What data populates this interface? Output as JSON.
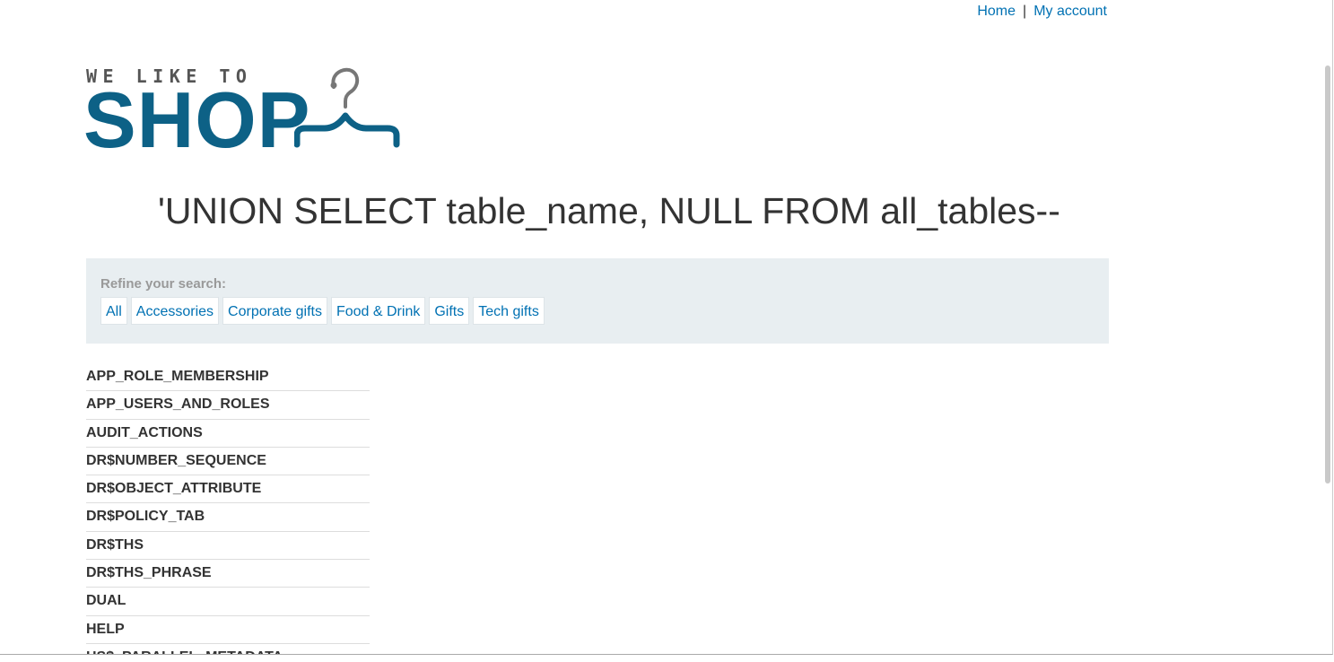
{
  "header": {
    "links": [
      {
        "label": "Home"
      },
      {
        "label": "My account"
      }
    ],
    "separator": "|"
  },
  "logo": {
    "tagline": "WE LIKE TO",
    "wordmark": "SHOP",
    "icon": "hanger-icon"
  },
  "page": {
    "heading": "'UNION SELECT table_name, NULL FROM all_tables--"
  },
  "filters": {
    "label": "Refine your search:",
    "items": [
      {
        "label": "All"
      },
      {
        "label": "Accessories"
      },
      {
        "label": "Corporate gifts"
      },
      {
        "label": "Food & Drink"
      },
      {
        "label": "Gifts"
      },
      {
        "label": "Tech gifts"
      }
    ]
  },
  "results": [
    "APP_ROLE_MEMBERSHIP",
    "APP_USERS_AND_ROLES",
    "AUDIT_ACTIONS",
    "DR$NUMBER_SEQUENCE",
    "DR$OBJECT_ATTRIBUTE",
    "DR$POLICY_TAB",
    "DR$THS",
    "DR$THS_PHRASE",
    "DUAL",
    "HELP",
    "HS$_PARALLEL_METADATA"
  ],
  "colors": {
    "link": "#0071b3",
    "brand": "#0d6186",
    "filter_bg": "#e8eef1",
    "text": "#333333"
  }
}
